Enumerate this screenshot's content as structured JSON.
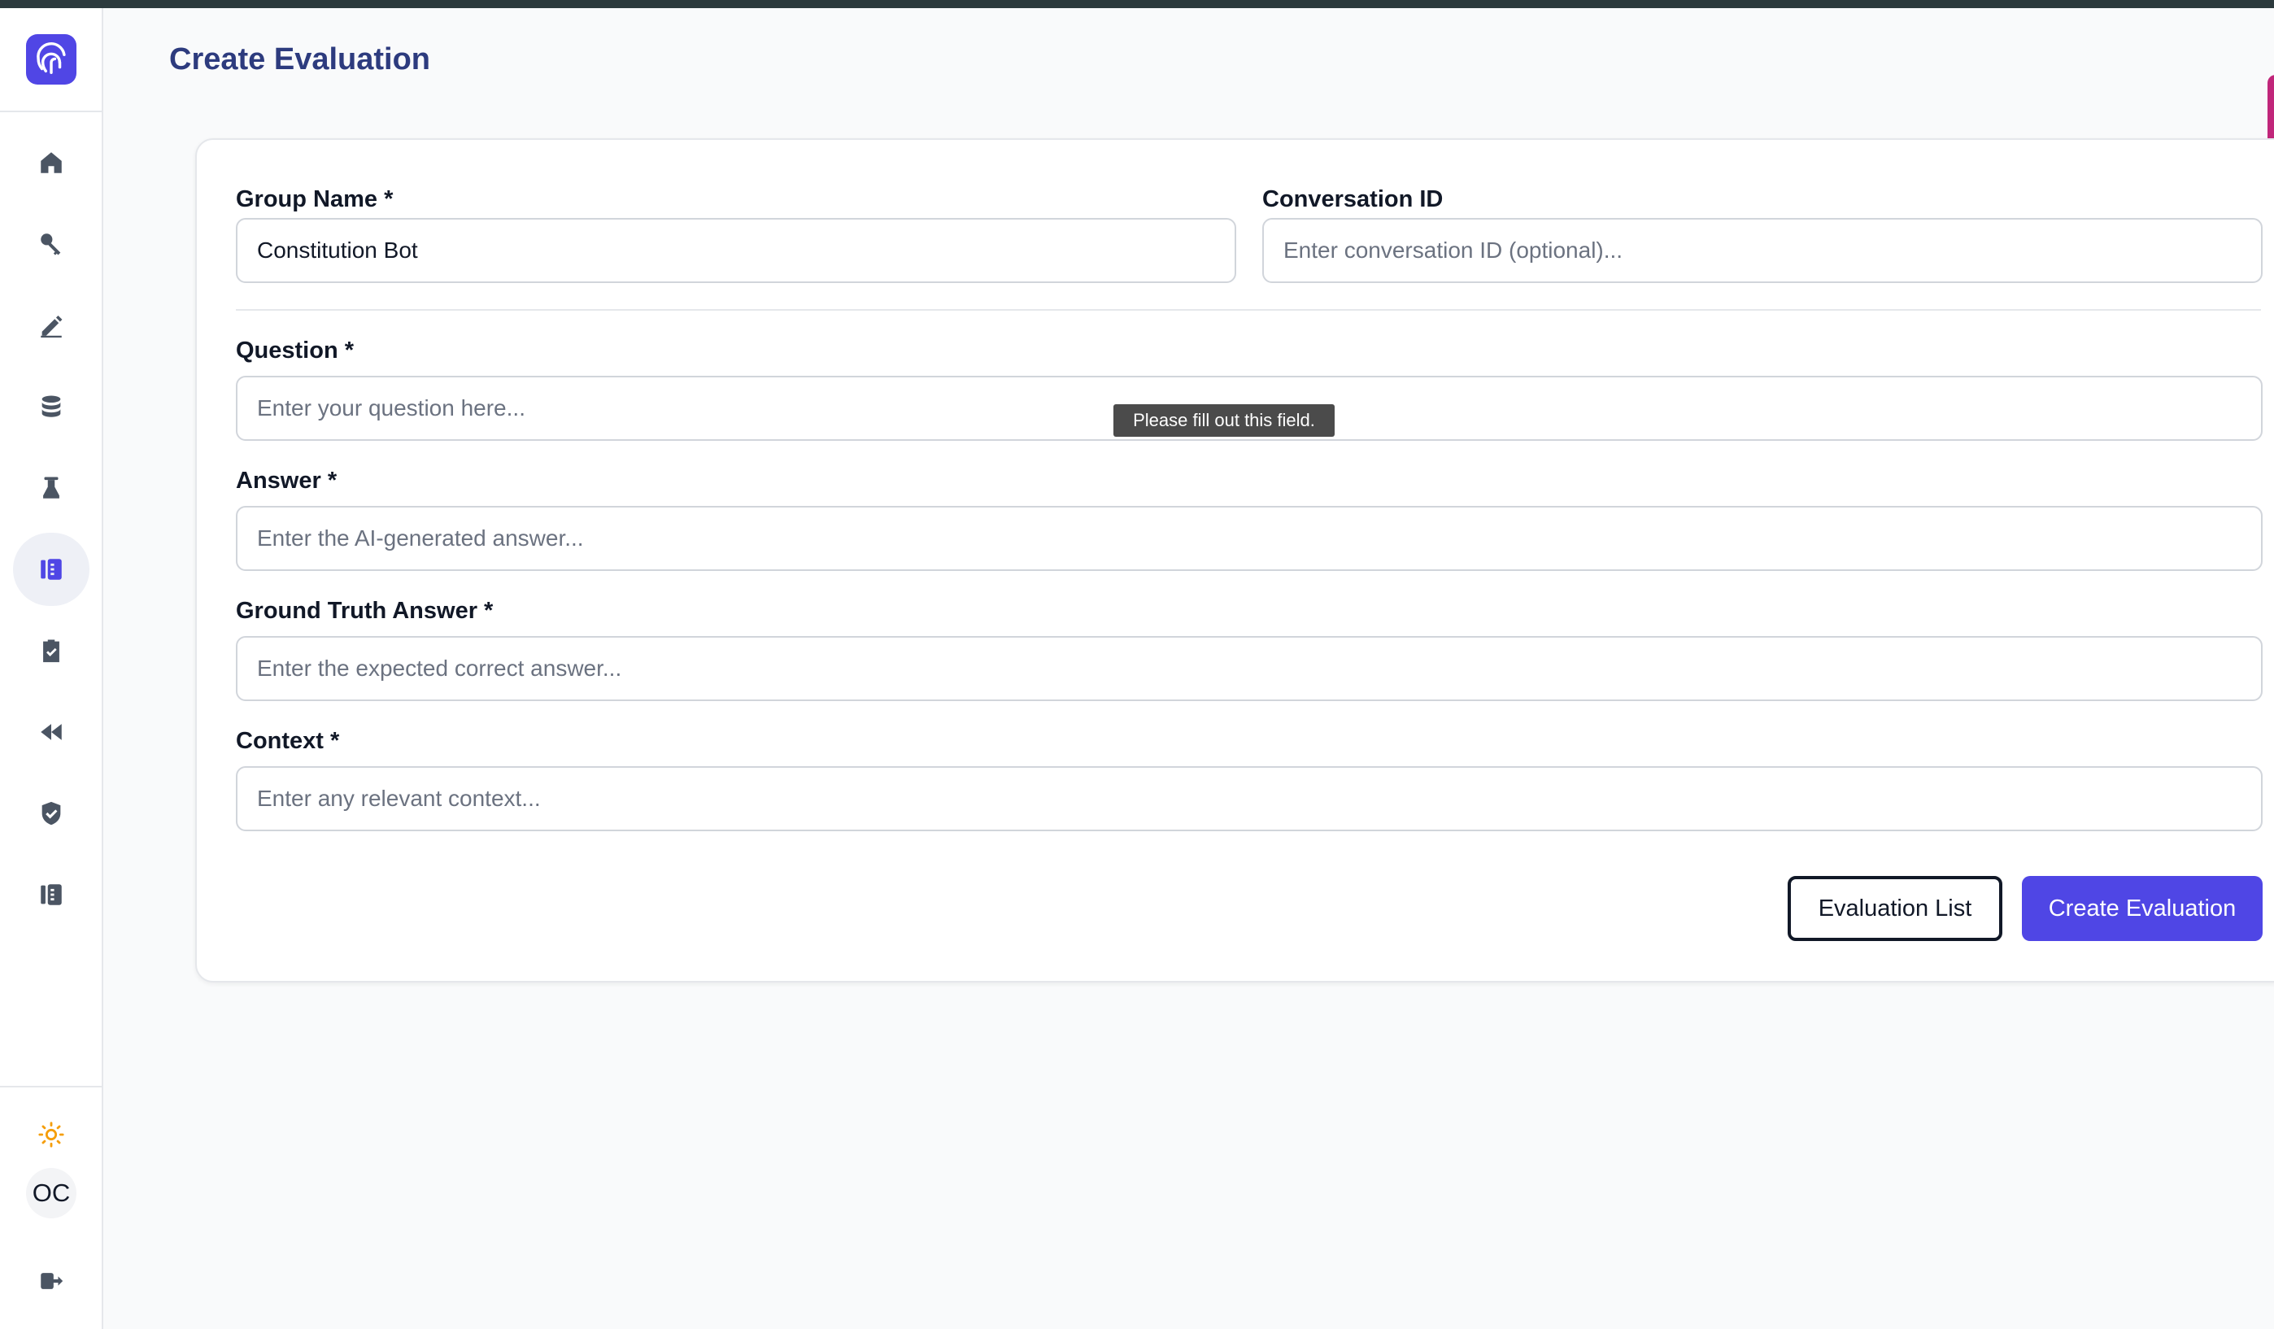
{
  "page": {
    "title": "Create Evaluation"
  },
  "sidebar": {
    "logo_icon": "fingerprint-logo-icon",
    "items": [
      {
        "name": "home",
        "icon": "home-icon",
        "active": false
      },
      {
        "name": "keys",
        "icon": "key-icon",
        "active": false
      },
      {
        "name": "edit",
        "icon": "pencil-icon",
        "active": false
      },
      {
        "name": "database",
        "icon": "database-icon",
        "active": false
      },
      {
        "name": "lab",
        "icon": "beaker-icon",
        "active": false
      },
      {
        "name": "evaluations",
        "icon": "evaluation-icon",
        "active": true
      },
      {
        "name": "tasks",
        "icon": "clipboard-check-icon",
        "active": false
      },
      {
        "name": "rewind",
        "icon": "rewind-icon",
        "active": false
      },
      {
        "name": "verified",
        "icon": "shield-check-icon",
        "active": false
      },
      {
        "name": "reports",
        "icon": "report-icon",
        "active": false
      }
    ],
    "theme_icon": "sun-icon",
    "avatar_initials": "OC",
    "logout_icon": "logout-icon"
  },
  "form": {
    "group_name": {
      "label": "Group Name *",
      "value": "Constitution Bot"
    },
    "conversation_id": {
      "label": "Conversation ID",
      "placeholder": "Enter conversation ID (optional)..."
    },
    "question": {
      "label": "Question *",
      "placeholder": "Enter your question here..."
    },
    "answer": {
      "label": "Answer *",
      "placeholder": "Enter the AI-generated answer..."
    },
    "ground_truth": {
      "label": "Ground Truth Answer *",
      "placeholder": "Enter the expected correct answer..."
    },
    "context": {
      "label": "Context *",
      "placeholder": "Enter any relevant context..."
    },
    "validation_tooltip": "Please fill out this field.",
    "buttons": {
      "list": "Evaluation List",
      "create": "Create Evaluation"
    }
  },
  "colors": {
    "accent": "#4f46e5",
    "title": "#2d3b7e",
    "icon": "#4b5563",
    "active_icon": "#4f46e5"
  }
}
